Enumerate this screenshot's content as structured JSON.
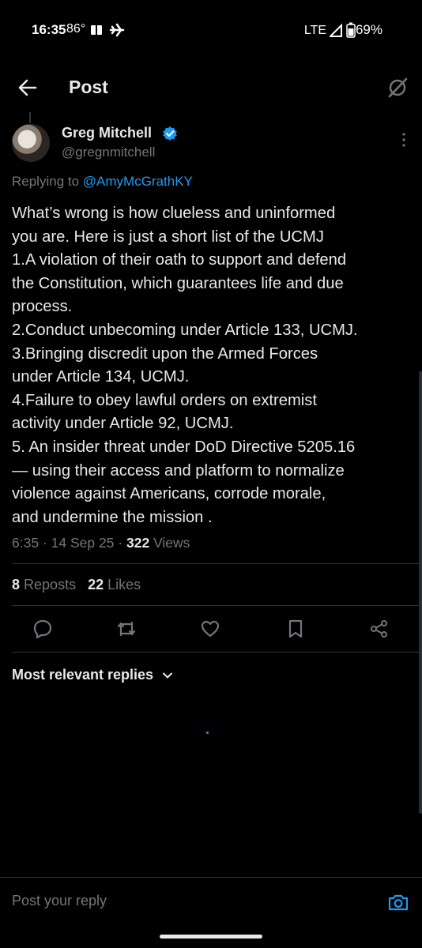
{
  "status_bar": {
    "time": "16:35",
    "temp": "86°",
    "network": "LTE",
    "battery": "69%"
  },
  "header": {
    "title": "Post"
  },
  "post": {
    "author_name": "Greg Mitchell",
    "author_handle": "@gregnmitchell",
    "replying_prefix": "Replying to ",
    "replying_to": "@AmyMcGrathKY",
    "lines": [
      "What’s wrong is how clueless and uninformed",
      "you are. Here is just a short list of the UCMJ",
      "1.A violation of their oath to support and defend",
      "the Constitution, which guarantees life and due",
      "process.",
      "2.Conduct unbecoming under Article 133, UCMJ.",
      "3.Bringing discredit upon the Armed Forces",
      "under Article 134, UCMJ.",
      "4.Failure to obey lawful orders on extremist",
      "activity under Article 92, UCMJ.",
      "5. An insider threat under DoD Directive 5205.16",
      "— using their access and platform to normalize",
      "violence against Americans, corrode morale,",
      "and undermine the mission ."
    ],
    "time": "6:35",
    "date": "14 Sep 25",
    "views_count": "322",
    "views_label": "Views",
    "reposts_count": "8",
    "reposts_label": "Reposts",
    "likes_count": "22",
    "likes_label": "Likes"
  },
  "replies": {
    "sort_label": "Most relevant replies"
  },
  "composer": {
    "placeholder": "Post your reply"
  },
  "icons": {
    "accent": "#1d9bf0",
    "back": "arrow-left-icon",
    "grok": "grok-icon",
    "more": "more-vertical-icon",
    "reply": "reply-icon",
    "repost": "repost-icon",
    "like": "heart-icon",
    "bookmark": "bookmark-icon",
    "share": "share-icon",
    "camera": "camera-icon"
  }
}
